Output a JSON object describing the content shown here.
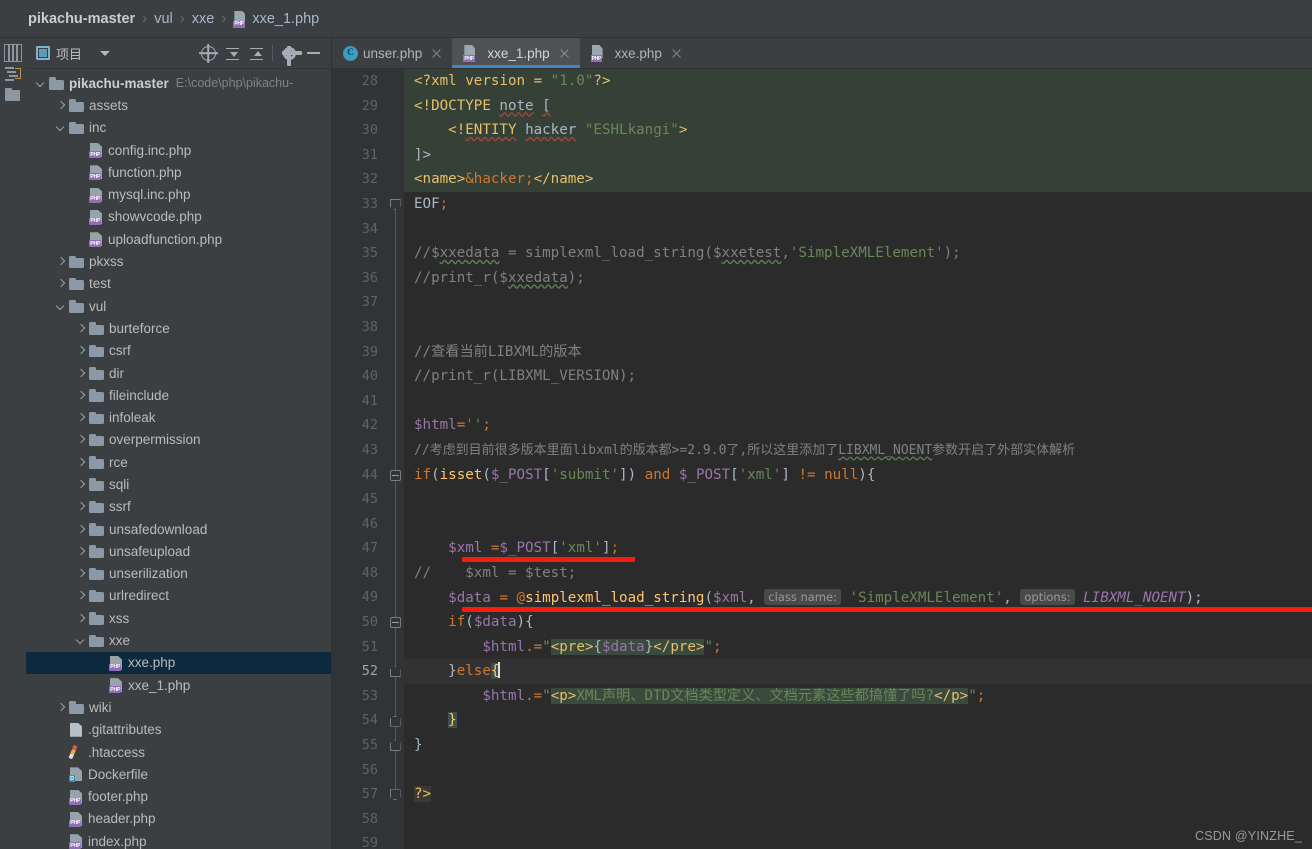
{
  "breadcrumb": {
    "items": [
      "pikachu-master",
      "vul",
      "xxe"
    ],
    "file": "xxe_1.php",
    "separator": "›"
  },
  "project_panel": {
    "title": "项目",
    "icons": [
      "locate-icon",
      "expand-all-icon",
      "collapse-all-icon",
      "settings-icon",
      "minimize-icon"
    ],
    "tree": [
      {
        "label": "pikachu-master",
        "path": "E:\\code\\php\\pikachu-",
        "type": "folder",
        "state": "open",
        "depth": 0,
        "bold": true
      },
      {
        "label": "assets",
        "type": "folder",
        "state": "closed",
        "depth": 1
      },
      {
        "label": "inc",
        "type": "folder",
        "state": "open",
        "depth": 1
      },
      {
        "label": "config.inc.php",
        "type": "php",
        "depth": 2
      },
      {
        "label": "function.php",
        "type": "php",
        "depth": 2
      },
      {
        "label": "mysql.inc.php",
        "type": "php",
        "depth": 2
      },
      {
        "label": "showvcode.php",
        "type": "php",
        "depth": 2
      },
      {
        "label": "uploadfunction.php",
        "type": "php",
        "depth": 2
      },
      {
        "label": "pkxss",
        "type": "folder",
        "state": "closed",
        "depth": 1
      },
      {
        "label": "test",
        "type": "folder",
        "state": "closed",
        "depth": 1
      },
      {
        "label": "vul",
        "type": "folder",
        "state": "open",
        "depth": 1
      },
      {
        "label": "burteforce",
        "type": "folder",
        "state": "closed",
        "depth": 2
      },
      {
        "label": "csrf",
        "type": "folder",
        "state": "closed",
        "depth": 2
      },
      {
        "label": "dir",
        "type": "folder",
        "state": "closed",
        "depth": 2
      },
      {
        "label": "fileinclude",
        "type": "folder",
        "state": "closed",
        "depth": 2
      },
      {
        "label": "infoleak",
        "type": "folder",
        "state": "closed",
        "depth": 2
      },
      {
        "label": "overpermission",
        "type": "folder",
        "state": "closed",
        "depth": 2
      },
      {
        "label": "rce",
        "type": "folder",
        "state": "closed",
        "depth": 2
      },
      {
        "label": "sqli",
        "type": "folder",
        "state": "closed",
        "depth": 2
      },
      {
        "label": "ssrf",
        "type": "folder",
        "state": "closed",
        "depth": 2
      },
      {
        "label": "unsafedownload",
        "type": "folder",
        "state": "closed",
        "depth": 2
      },
      {
        "label": "unsafeupload",
        "type": "folder",
        "state": "closed",
        "depth": 2
      },
      {
        "label": "unserilization",
        "type": "folder",
        "state": "closed",
        "depth": 2
      },
      {
        "label": "urlredirect",
        "type": "folder",
        "state": "closed",
        "depth": 2
      },
      {
        "label": "xss",
        "type": "folder",
        "state": "closed",
        "depth": 2
      },
      {
        "label": "xxe",
        "type": "folder",
        "state": "open",
        "depth": 2
      },
      {
        "label": "xxe.php",
        "type": "php",
        "depth": 3,
        "selected": true
      },
      {
        "label": "xxe_1.php",
        "type": "php",
        "depth": 3
      },
      {
        "label": "wiki",
        "type": "folder",
        "state": "closed",
        "depth": 1
      },
      {
        "label": ".gitattributes",
        "type": "git",
        "depth": 1
      },
      {
        "label": ".htaccess",
        "type": "htaccess",
        "depth": 1
      },
      {
        "label": "Dockerfile",
        "type": "docker",
        "depth": 1
      },
      {
        "label": "footer.php",
        "type": "php",
        "depth": 1
      },
      {
        "label": "header.php",
        "type": "php",
        "depth": 1
      },
      {
        "label": "index.php",
        "type": "php",
        "depth": 1
      }
    ]
  },
  "editor_tabs": [
    {
      "label": "unser.php",
      "icon": "class-icon",
      "active": false
    },
    {
      "label": "xxe_1.php",
      "icon": "php-icon",
      "active": true
    },
    {
      "label": "xxe.php",
      "icon": "php-icon",
      "active": false
    }
  ],
  "editor": {
    "first_line": 28,
    "last_line": 59,
    "cursor_line": 52,
    "lines": {
      "28": "<?xml version = \"1.0\"?>",
      "29": "<!DOCTYPE note [",
      "30": "    <!ENTITY hacker \"ESHLkangi\">",
      "31": "]>",
      "32": "<name>&hacker;</name>",
      "33": "EOF;",
      "34": "",
      "35": "//$xxedata = simplexml_load_string($xxetest,'SimpleXMLElement');",
      "36": "//print_r($xxedata);",
      "37": "",
      "38": "",
      "39": "//查看当前LIBXML的版本",
      "40": "//print_r(LIBXML_VERSION);",
      "41": "",
      "42": "$html='';",
      "43": "//考虑到目前很多版本里面libxml的版本都>=2.9.0了,所以这里添加了LIBXML_NOENT参数开启了外部实体解析",
      "44": "if(isset($_POST['submit']) and $_POST['xml'] != null){",
      "45": "",
      "46": "",
      "47": "    $xml =$_POST['xml'];",
      "48": "//    $xml = $test;",
      "49": "    $data = @simplexml_load_string($xml, class name: 'SimpleXMLElement', options: LIBXML_NOENT);",
      "50": "    if($data){",
      "51": "        $html.=\"<pre>{$data}</pre>\";",
      "52": "    }else{",
      "53": "        $html.=\"<p>XML声明、DTD文档类型定义、文档元素这些都搞懂了吗?</p>\";",
      "54": "    }",
      "55": "}",
      "56": "",
      "57": "?>",
      "58": "",
      "59": ""
    },
    "inlay_hints": [
      {
        "line": 49,
        "text": "class name:"
      },
      {
        "line": 49,
        "text": "options:"
      }
    ],
    "annotations": [
      {
        "type": "red-underline",
        "line": 47,
        "note": "highlights $_POST['xml'] assignment"
      },
      {
        "type": "red-underline",
        "line": 49,
        "note": "highlights simplexml_load_string LIBXML_NOENT call"
      }
    ],
    "gutter_icon": {
      "line": 52,
      "icon": "lightbulb-icon"
    }
  },
  "watermark": "CSDN @YINZHE_",
  "colors": {
    "accent": "#3f86c4",
    "selection": "#0d293e",
    "heredoc_bg": "#354136",
    "annotation_red": "#f71c0e",
    "keyword": "#cc7832",
    "string": "#6a8759",
    "variable": "#9876aa",
    "function": "#ffc66d",
    "comment": "#808080",
    "tag": "#e8bf6a"
  }
}
